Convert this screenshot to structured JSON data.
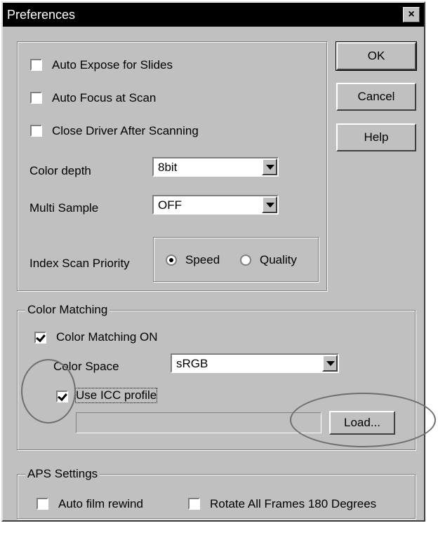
{
  "window": {
    "title": "Preferences",
    "close_glyph": "×"
  },
  "buttons": {
    "ok": "OK",
    "cancel": "Cancel",
    "help": "Help",
    "load": "Load..."
  },
  "general": {
    "auto_expose": {
      "label": "Auto Expose for Slides",
      "checked": false
    },
    "auto_focus": {
      "label": "Auto Focus at Scan",
      "checked": false
    },
    "close_driver": {
      "label": "Close Driver After Scanning",
      "checked": false
    },
    "color_depth": {
      "label": "Color depth",
      "value": "8bit"
    },
    "multi_sample": {
      "label": "Multi Sample",
      "value": "OFF"
    },
    "index_scan": {
      "label": "Index Scan Priority",
      "speed": "Speed",
      "quality": "Quality",
      "selected": "Speed"
    }
  },
  "color_matching": {
    "group_label": "Color Matching",
    "enabled": {
      "label": "Color Matching ON",
      "checked": true
    },
    "color_space": {
      "label": "Color Space",
      "value": "sRGB"
    },
    "use_icc": {
      "label": "Use ICC profile",
      "checked": true
    },
    "profile_path": ""
  },
  "aps": {
    "group_label": "APS Settings",
    "auto_rewind": {
      "label": "Auto film rewind",
      "checked": false
    },
    "rotate": {
      "label": "Rotate All Frames 180 Degrees",
      "checked": false
    }
  },
  "annotations": {
    "circle_color": "#6e6e6e"
  }
}
